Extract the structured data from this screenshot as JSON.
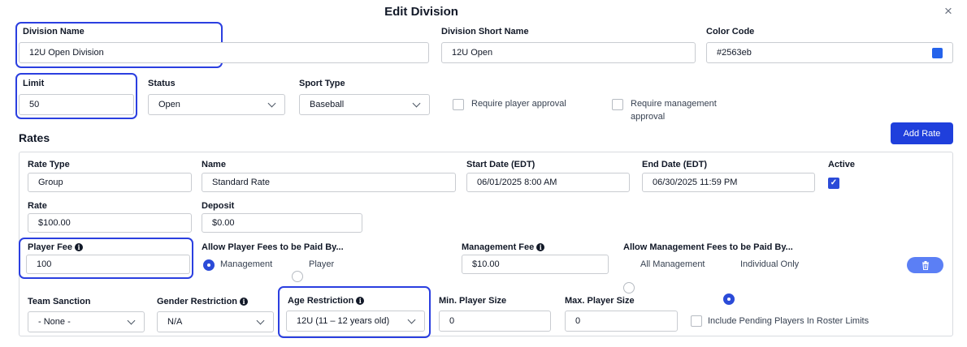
{
  "dialog": {
    "title": "Edit Division",
    "close_icon": "×"
  },
  "division": {
    "name_label": "Division Name",
    "name_value": "12U Open Division",
    "short_label": "Division Short Name",
    "short_value": "12U Open",
    "color_label": "Color Code",
    "color_value": "#2563eb",
    "swatch_color": "#2563eb",
    "limit_label": "Limit",
    "limit_value": "50",
    "status_label": "Status",
    "status_value": "Open",
    "sport_label": "Sport Type",
    "sport_value": "Baseball",
    "require_player_label": "Require player approval",
    "require_player_checked": false,
    "require_mgmt_label_1": "Require management",
    "require_mgmt_label_2": "approval",
    "require_mgmt_checked": false
  },
  "rates": {
    "heading": "Rates",
    "add_button": "Add Rate",
    "rate_type_label": "Rate Type",
    "rate_type_value": "Group",
    "name_label": "Name",
    "name_value": "Standard Rate",
    "start_label": "Start Date (EDT)",
    "start_value": "06/01/2025 8:00 AM",
    "end_label": "End Date (EDT)",
    "end_value": "06/30/2025 11:59 PM",
    "active_label": "Active",
    "active_checked": true,
    "check_glyph": "✓",
    "rate_label": "Rate",
    "rate_value": "$100.00",
    "deposit_label": "Deposit",
    "deposit_value": "$0.00",
    "player_fee_label": "Player Fee",
    "player_fee_value": "100",
    "info_glyph": "i",
    "allow_player_label": "Allow Player Fees to be Paid By...",
    "allow_player_options": [
      "Management",
      "Player"
    ],
    "allow_player_selected": "Management",
    "mgmt_fee_label": "Management Fee",
    "mgmt_fee_value": "$10.00",
    "allow_mgmt_label": "Allow Management Fees to be Paid By...",
    "allow_mgmt_options": [
      "All Management",
      "Individual Only"
    ],
    "allow_mgmt_selected": "Individual Only",
    "team_sanction_label": "Team Sanction",
    "team_sanction_value": "- None -",
    "gender_label": "Gender Restriction",
    "gender_value": "N/A",
    "age_label": "Age Restriction",
    "age_value": "12U (11 – 12 years old)",
    "min_label": "Min. Player Size",
    "min_value": "0",
    "max_label": "Max. Player Size",
    "max_value": "0",
    "pending_label": "Include Pending Players In Roster Limits",
    "pending_checked": false
  },
  "colors": {
    "accent": "#1f3fdc",
    "highlight": "#2b3fe0",
    "trash_button": "#5b7ff5"
  }
}
